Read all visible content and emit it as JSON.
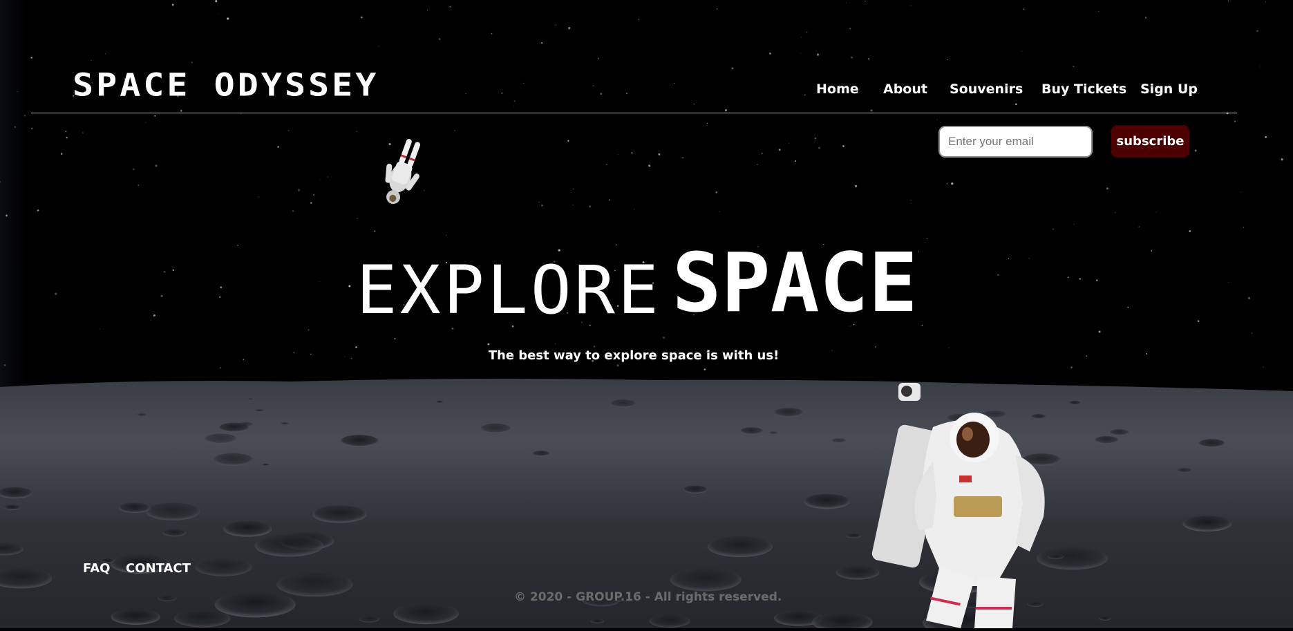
{
  "header": {
    "logo": "SPACE ODYSSEY",
    "nav": [
      {
        "label": "Home"
      },
      {
        "label": "About"
      },
      {
        "label": "Souvenirs"
      },
      {
        "label": "Buy Tickets"
      },
      {
        "label": "Sign Up"
      }
    ]
  },
  "subscribe": {
    "placeholder": "Enter your email",
    "button_label": "subscribe",
    "button_color": "#4d0000"
  },
  "hero": {
    "title_part1": "EXPLORE",
    "title_part2": "SPACE",
    "tagline": "The best way to explore space is with us!"
  },
  "footer": {
    "links": [
      {
        "label": "FAQ"
      },
      {
        "label": "CONTACT"
      }
    ],
    "copyright": "© 2020 - GROUP.16 - All rights reserved."
  },
  "images": {
    "background": "moon-surface-starfield",
    "astronaut_small": "floating-astronaut",
    "astronaut_large": "astronaut-spacesuit"
  }
}
